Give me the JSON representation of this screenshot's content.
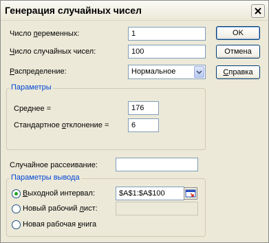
{
  "window": {
    "title": "Генерация случайных чисел"
  },
  "fields": {
    "num_variables": {
      "label_pre": "Число ",
      "label_u": "п",
      "label_post": "еременных:",
      "value": "1"
    },
    "num_random": {
      "label_pre": "",
      "label_u": "Ч",
      "label_post": "исло случайных чисел:",
      "value": "100"
    },
    "distribution": {
      "label_pre": "",
      "label_u": "Р",
      "label_post": "аспределение:",
      "value": "Нормальное"
    },
    "random_seed": {
      "label": "Случайное рассеивание:",
      "value": ""
    }
  },
  "buttons": {
    "ok": "OK",
    "cancel": "Отмена",
    "help": "Справка"
  },
  "params_group": {
    "title": "Параметры",
    "mean": {
      "label": "Среднее =",
      "value": "176"
    },
    "std": {
      "label_pre": "Стандартное ",
      "label_u": "о",
      "label_post": "тклонение =",
      "value": "6"
    }
  },
  "output_group": {
    "title": "Параметры вывода",
    "options": [
      {
        "label_pre": "",
        "label_u": "В",
        "label_post": "ыходной интервал:",
        "checked": true
      },
      {
        "label_pre": "Новый рабочий ",
        "label_u": "л",
        "label_post": "ист:",
        "checked": false
      },
      {
        "label_pre": "Новая рабочая ",
        "label_u": "к",
        "label_post": "нига",
        "checked": false
      }
    ],
    "output_range": "$A$1:$A$100",
    "new_sheet_name": ""
  },
  "icons": {
    "close": "close-icon",
    "dropdown": "chevron-down-icon",
    "range_select": "range-select-icon"
  },
  "colors": {
    "group_title": "#0046d5",
    "radio_dot": "#21a121",
    "range_icon_red": "#d62a1f",
    "range_icon_blue": "#2b4fbf"
  }
}
